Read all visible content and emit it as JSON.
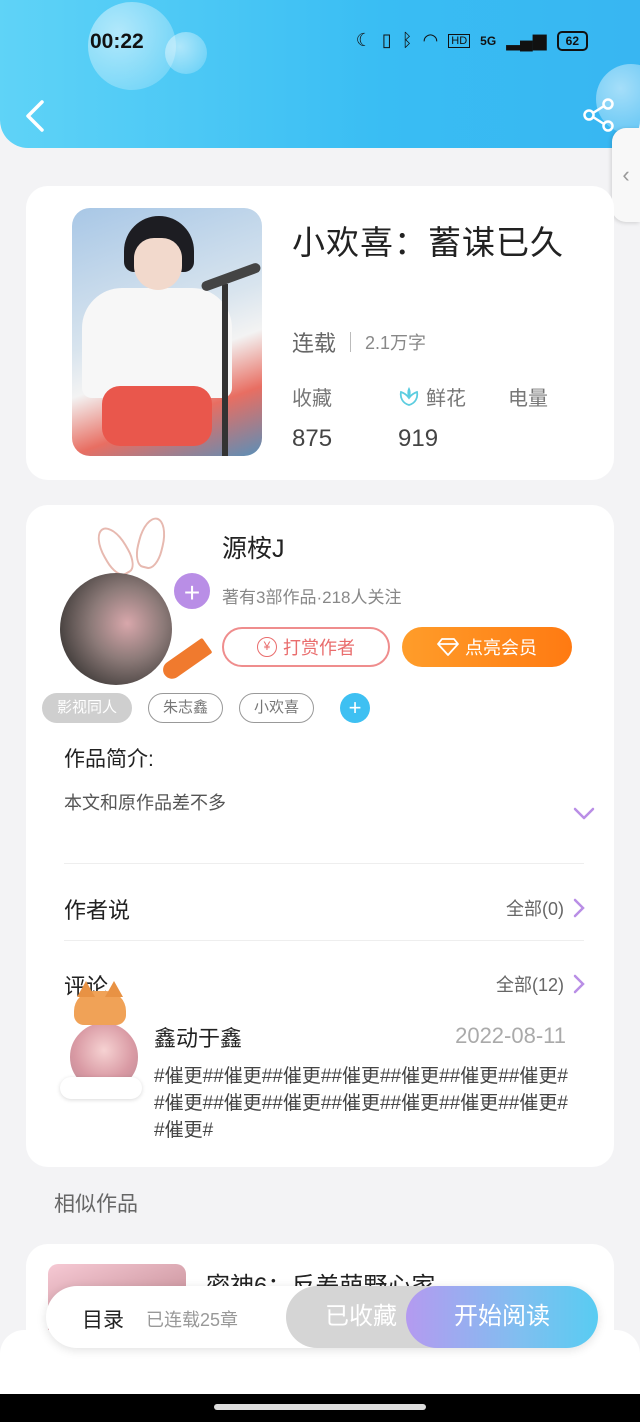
{
  "status_bar": {
    "time": "00:22",
    "network": "5G",
    "hd": "HD",
    "battery": "62"
  },
  "book": {
    "title": "小欢喜：蓄谋已久",
    "status": "连载",
    "word_count": "2.1万字",
    "stats": [
      {
        "label": "收藏",
        "value": "875"
      },
      {
        "label": "鲜花",
        "value": "919"
      },
      {
        "label": "电量",
        "value": ""
      }
    ]
  },
  "author": {
    "name": "源桉J",
    "meta": "著有3部作品·218人关注",
    "reward_label": "打赏作者",
    "vip_label": "点亮会员"
  },
  "tags": [
    "影视同人",
    "朱志鑫",
    "小欢喜"
  ],
  "intro": {
    "title": "作品简介:",
    "text": "本文和原作品差不多"
  },
  "author_says": {
    "title": "作者说",
    "more": "全部(0)"
  },
  "comments": {
    "title": "评论",
    "more": "全部(12)",
    "items": [
      {
        "user": "鑫动于鑫",
        "date": "2022-08-11",
        "text": "#催更##催更##催更##催更##催更##催更##催更##催更##催更##催更##催更##催更##催更##催更##催更#"
      }
    ]
  },
  "similar": {
    "label": "相似作品",
    "first_title": "密神6：反差萌野心家"
  },
  "bottom_bar": {
    "catalog": "目录",
    "chapters": "已连载25章",
    "fav": "已收藏",
    "read": "开始阅读"
  },
  "colors": {
    "header": "#39bdf3",
    "accent_orange": "#ff8a1c",
    "accent_purple": "#b98ee6"
  }
}
